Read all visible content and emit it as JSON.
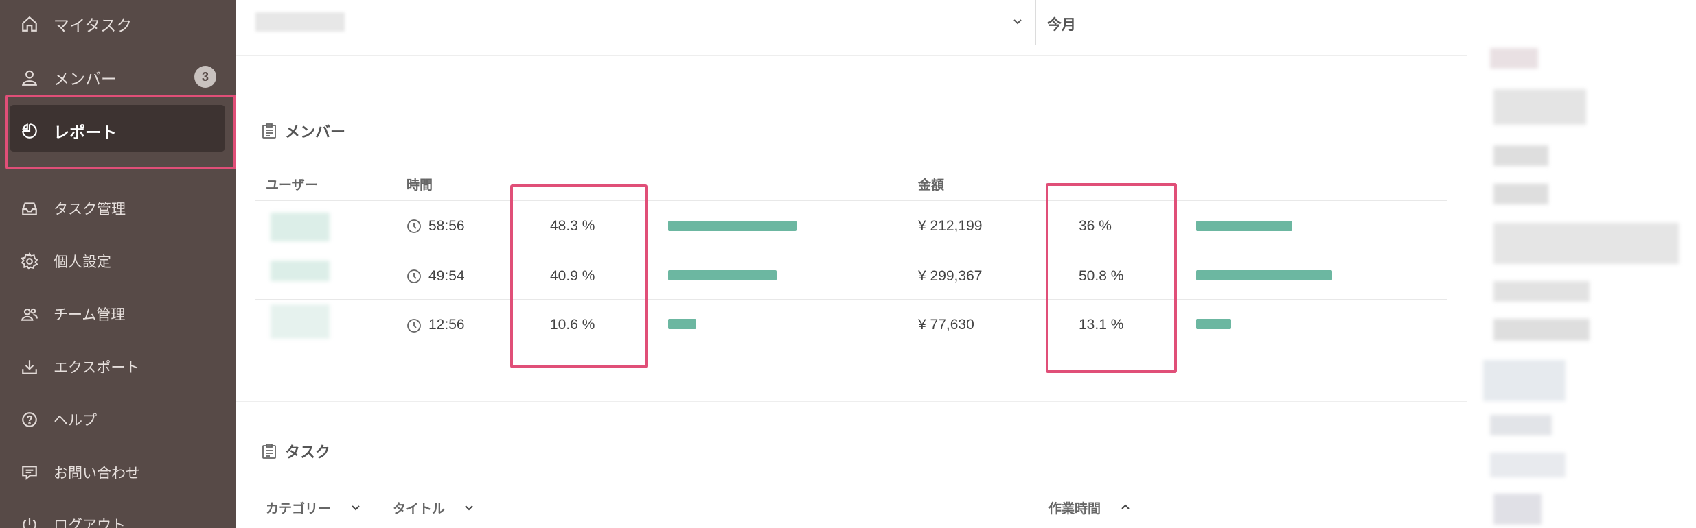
{
  "sidebar": {
    "items": [
      {
        "label": "マイタスク",
        "icon": "home-icon"
      },
      {
        "label": "メンバー",
        "icon": "user-icon",
        "badge": "3"
      },
      {
        "label": "レポート",
        "icon": "pie-chart-icon",
        "active": true
      },
      {
        "label": "タスク管理",
        "icon": "inbox-icon"
      },
      {
        "label": "個人設定",
        "icon": "gear-icon"
      },
      {
        "label": "チーム管理",
        "icon": "team-icon"
      },
      {
        "label": "エクスポート",
        "icon": "download-icon"
      },
      {
        "label": "ヘルプ",
        "icon": "help-icon"
      },
      {
        "label": "お問い合わせ",
        "icon": "message-icon"
      },
      {
        "label": "ログアウト",
        "icon": "power-icon"
      }
    ]
  },
  "topbar": {
    "period": "今月"
  },
  "members_section": {
    "title": "メンバー",
    "headers": {
      "user": "ユーザー",
      "time": "時間",
      "amount": "金額"
    },
    "rows": [
      {
        "time": "58:56",
        "time_pct": "48.3 %",
        "time_ratio": 0.483,
        "amount": "¥ 212,199",
        "amount_pct": "36 %",
        "amount_ratio": 0.36
      },
      {
        "time": "49:54",
        "time_pct": "40.9 %",
        "time_ratio": 0.409,
        "amount": "¥ 299,367",
        "amount_pct": "50.8 %",
        "amount_ratio": 0.508
      },
      {
        "time": "12:56",
        "time_pct": "10.6 %",
        "time_ratio": 0.106,
        "amount": "¥ 77,630",
        "amount_pct": "13.1 %",
        "amount_ratio": 0.131
      }
    ]
  },
  "tasks_section": {
    "title": "タスク",
    "headers": {
      "category": "カテゴリー",
      "title": "タイトル",
      "work_time": "作業時間"
    }
  },
  "colors": {
    "sidebar_bg": "#574a47",
    "bar": "#6cb7a1",
    "highlight": "#e04f78"
  }
}
